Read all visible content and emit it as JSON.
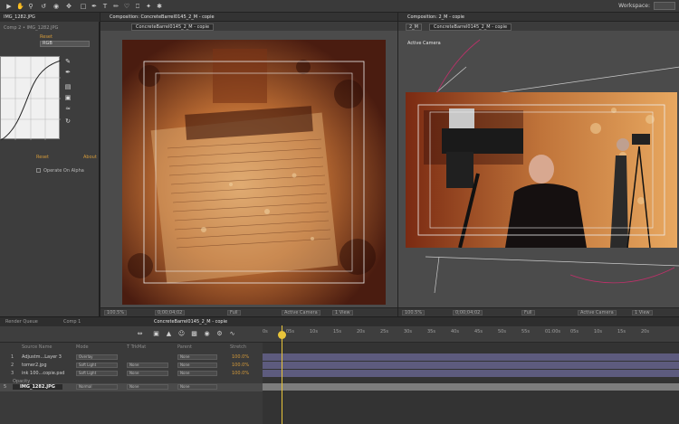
{
  "toolbar": {
    "workspace_label": "Workspace:",
    "tools": [
      "selection-icon",
      "hand-icon",
      "zoom-icon",
      "rotate-icon",
      "camera-orbit-icon",
      "pan-behind-icon",
      "rectangle-icon",
      "pen-icon",
      "text-icon",
      "brush-icon",
      "clone-icon",
      "eraser-icon",
      "roto-icon",
      "puppet-icon"
    ]
  },
  "left_panel": {
    "tab": "IMG_1282.JPG",
    "layer_line": "Comp 2 • IMG_1282.JPG",
    "reset_label": "Reset",
    "channel_value": "RGB",
    "curves_reset": "Reset",
    "curves_about": "About",
    "checkbox_label": "Operate On Alpha"
  },
  "viewer_left": {
    "tab_label": "Composition: ConcreteBarrel0145_2_M - copie",
    "breadcrumb": "ConcreteBarrel0145_2_M - copie",
    "status": {
      "zoom": "100.5%",
      "timecode": "0;00;04;02",
      "quality": "Full",
      "view": "Active Camera",
      "views": "1 View"
    }
  },
  "viewer_right": {
    "tab_label": "Composition: 2_M - copie",
    "breadcrumb_num": "2_M",
    "breadcrumb": "ConcreteBarrel0145_2_M - copie",
    "view_label": "Active Camera",
    "status": {
      "zoom": "100.5%",
      "timecode": "0;00;04;02",
      "quality": "Full",
      "view": "Active Camera",
      "views": "1 View"
    }
  },
  "timeline": {
    "tabs": [
      "Render Queue",
      "Comp 1",
      "ConcreteBarrel0145_2_M - copie"
    ],
    "active_tab": 2,
    "ticks": [
      "0s",
      "05s",
      "10s",
      "15s",
      "20s",
      "25s",
      "30s",
      "35s",
      "40s",
      "45s",
      "50s",
      "55s",
      "01:00s",
      "05s",
      "10s",
      "15s",
      "20s"
    ],
    "columns": [
      "Source Name",
      "Mode",
      "T TrkMat",
      "Parent",
      "Stretch"
    ],
    "layers": [
      {
        "num": "1",
        "name": "Adjustm...Layer 3",
        "mode": "Overlay",
        "trkmat": "",
        "parent": "None",
        "stretch": "100.0%"
      },
      {
        "num": "2",
        "name": "tomer2.jpg",
        "mode": "Soft Light",
        "trkmat": "None",
        "parent": "None",
        "stretch": "100.0%"
      },
      {
        "num": "3",
        "name": "ink 100...copie.psd",
        "mode": "Soft Light",
        "trkmat": "None",
        "parent": "None",
        "stretch": "100.0%"
      },
      {
        "num": "4",
        "name": "Opacity",
        "mode": "",
        "trkmat": "",
        "parent": "",
        "stretch": ""
      },
      {
        "num": "5",
        "name": "IMG_1282.JPG",
        "mode": "Normal",
        "trkmat": "None",
        "parent": "None",
        "stretch": ""
      }
    ],
    "playhead_position_s": 1
  },
  "colors": {
    "accent": "#d49a3a",
    "track": "#5d5b7e",
    "playhead": "#e8c43a"
  }
}
